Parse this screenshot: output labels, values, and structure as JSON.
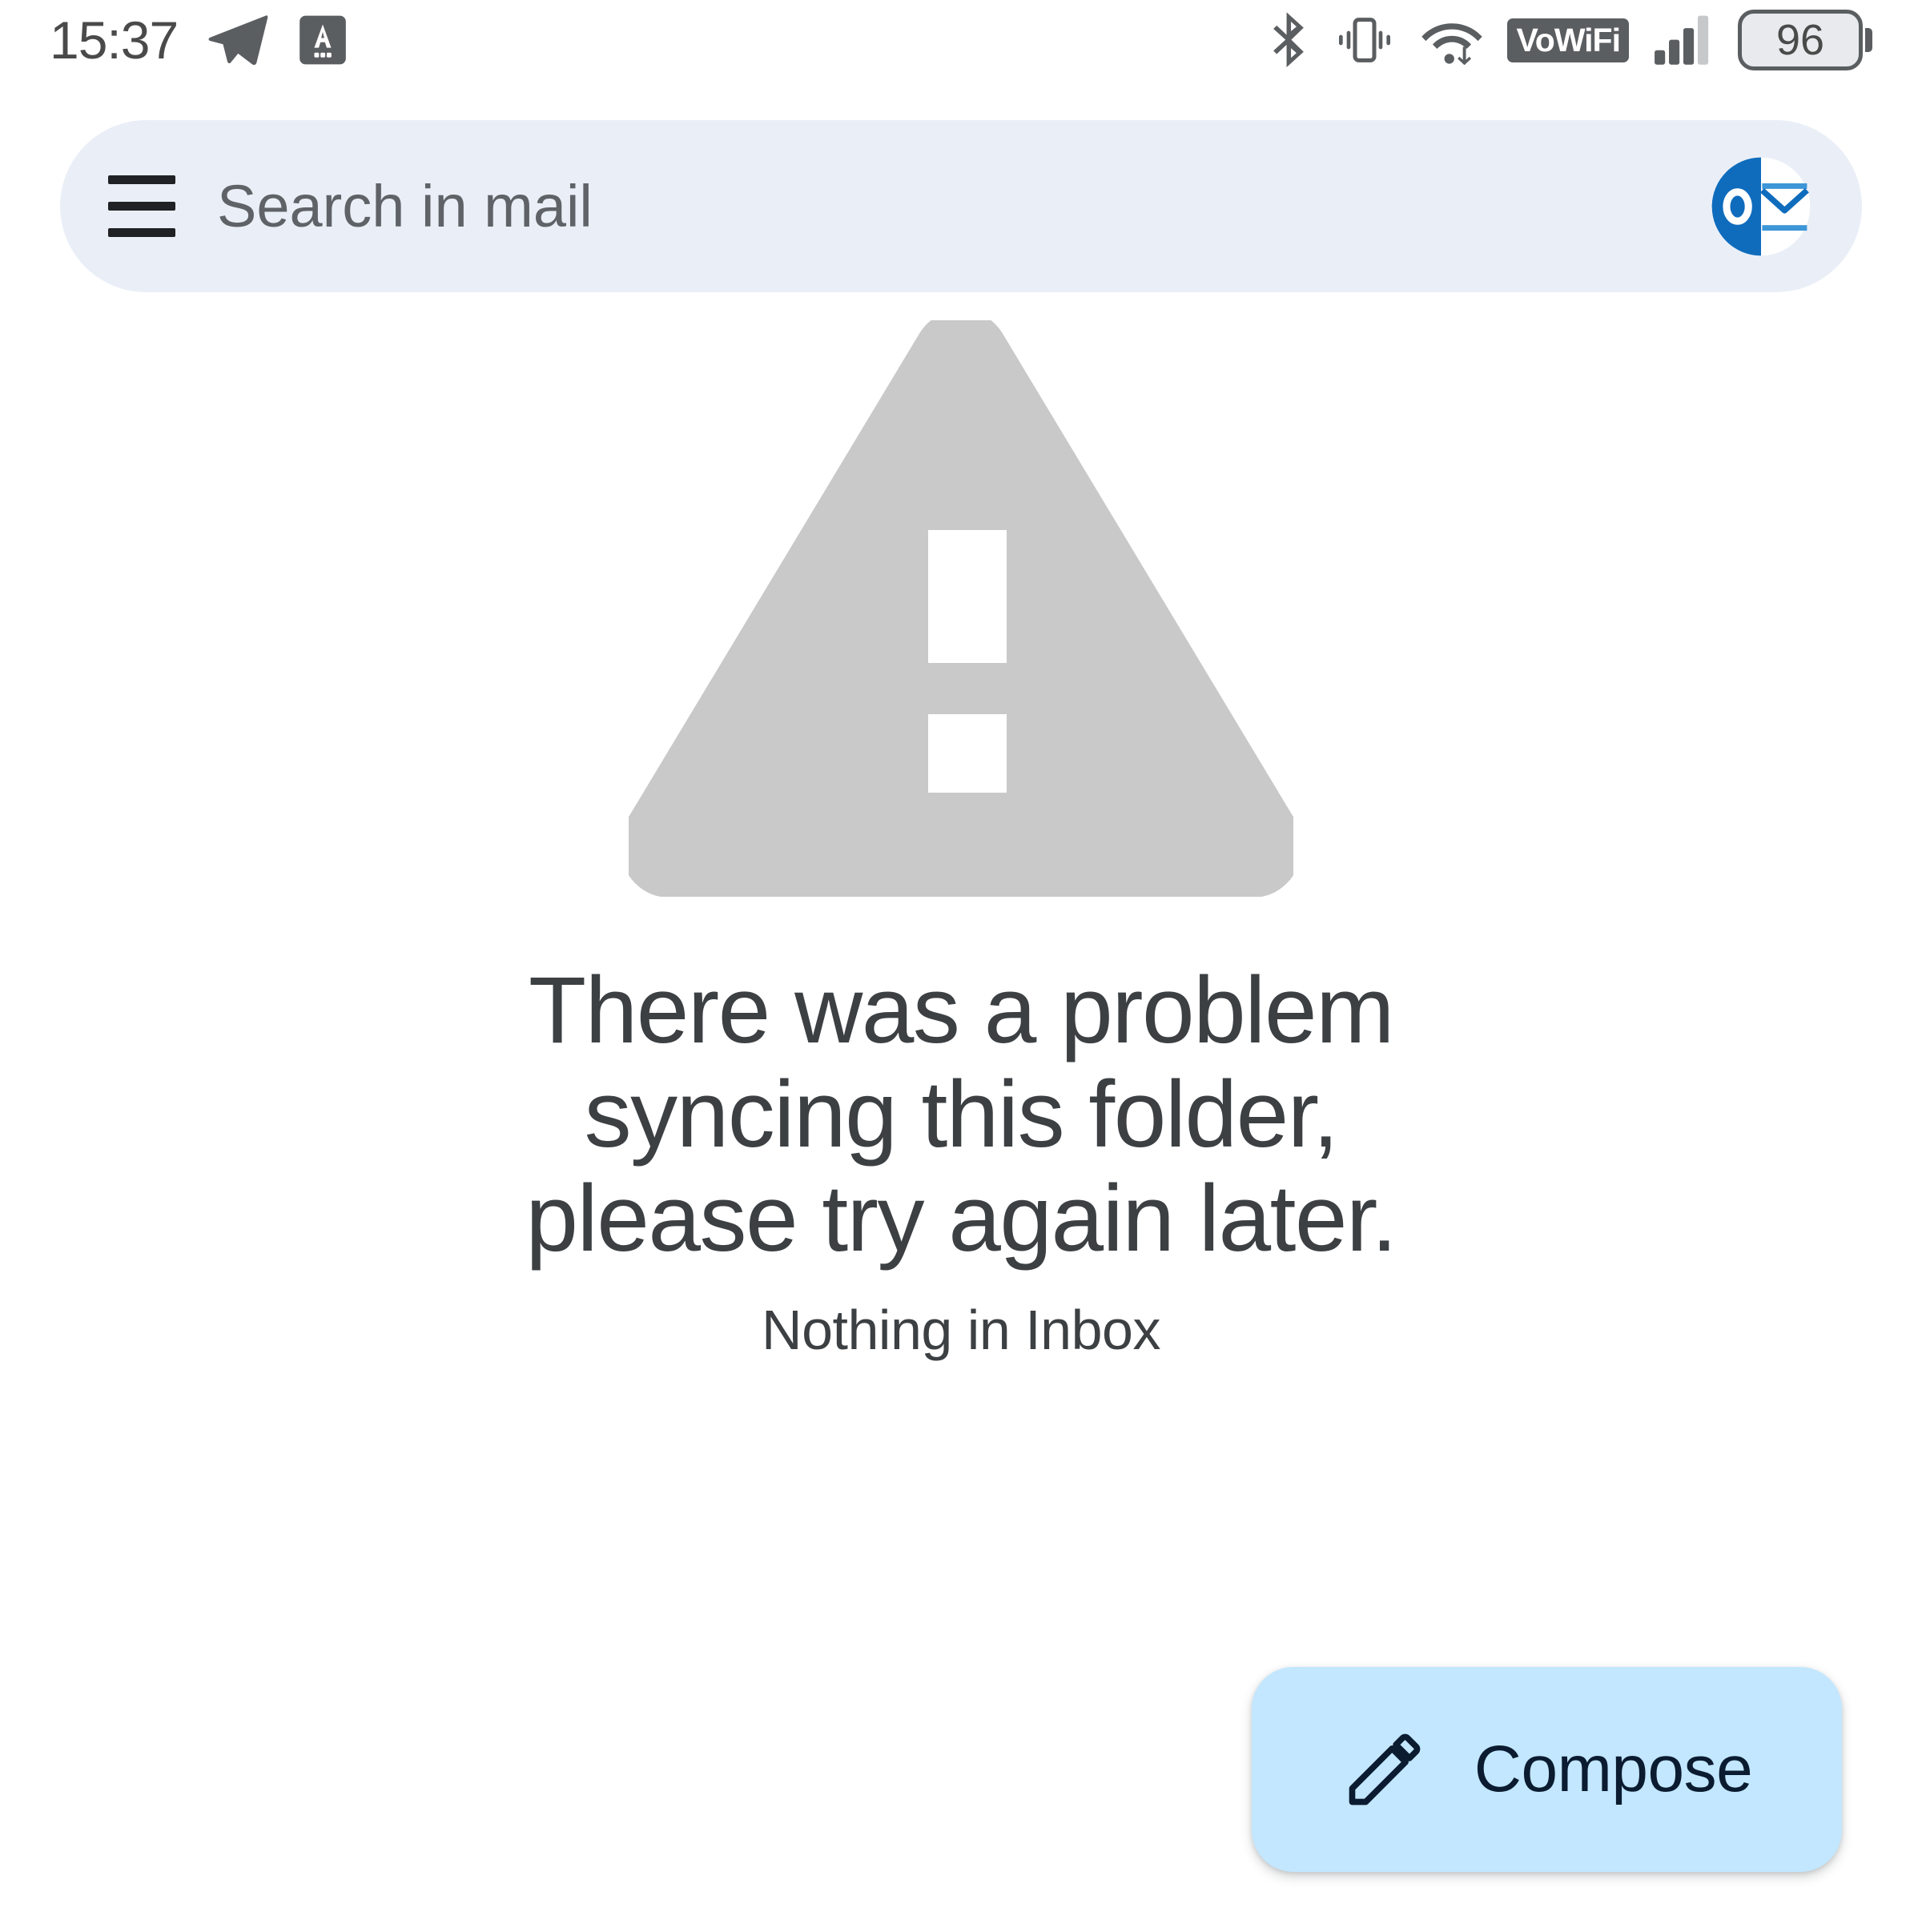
{
  "status_bar": {
    "clock": "15:37",
    "left_icons": [
      {
        "name": "telegram-send-icon",
        "label": "Telegram"
      },
      {
        "name": "translate-keyboard-icon",
        "label": "A"
      }
    ],
    "right_icons": [
      {
        "name": "bluetooth-icon",
        "label": "Bluetooth"
      },
      {
        "name": "vibrate-icon",
        "label": "Vibrate"
      },
      {
        "name": "wifi-icon",
        "label": "Wi-Fi"
      },
      {
        "name": "vowifi-badge",
        "label": "VoWiFi"
      },
      {
        "name": "signal-bars-icon",
        "label": "Signal"
      }
    ],
    "battery_level": "96"
  },
  "search": {
    "placeholder": "Search in mail",
    "value": "",
    "menu_icon": "hamburger-menu-icon",
    "avatar_icon": "outlook-account-avatar"
  },
  "empty_state": {
    "icon": "warning-triangle-icon",
    "icon_color": "#c9c9c9",
    "title": "There was a problem syncing this folder, please try again later.",
    "subtitle": "Nothing in Inbox",
    "text_color": "#3c4043"
  },
  "compose": {
    "label": "Compose",
    "icon": "pencil-edit-icon",
    "background_color": "#c2e7ff",
    "foreground_color": "#0b1b30"
  },
  "theme": {
    "page_background": "#ffffff",
    "search_background": "#eaeff7",
    "accent": "#0f6cbd"
  }
}
